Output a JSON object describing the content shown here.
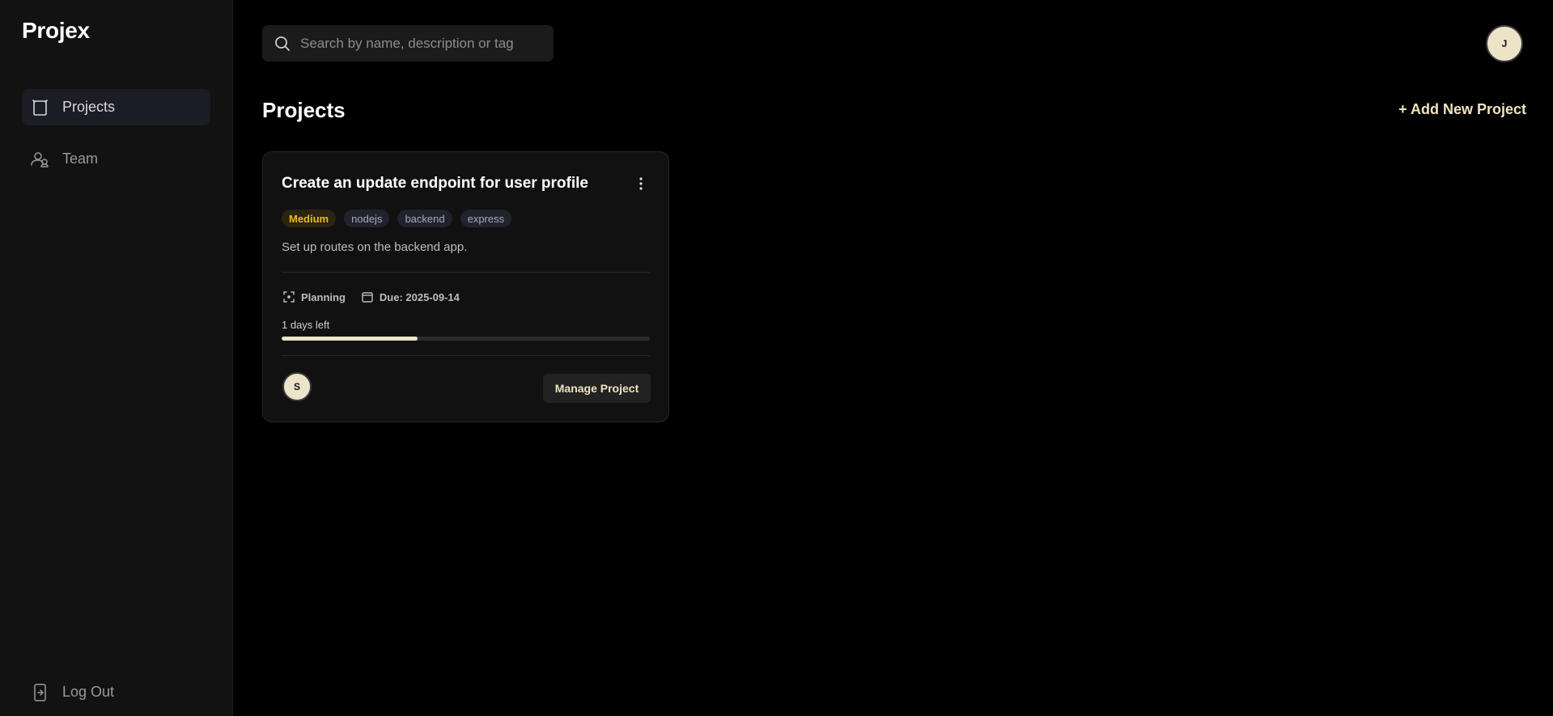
{
  "app": {
    "brand": "Projex"
  },
  "sidebar": {
    "items": [
      {
        "label": "Projects",
        "icon": "projects-icon",
        "active": true
      },
      {
        "label": "Team",
        "icon": "team-icon",
        "active": false
      }
    ],
    "logout_label": "Log Out",
    "logout_icon": "logout-icon"
  },
  "header": {
    "search_placeholder": "Search by name, description or tag",
    "search_value": "",
    "user_initial": "J"
  },
  "main": {
    "title": "Projects",
    "add_label": "+ Add New Project"
  },
  "projects": [
    {
      "title": "Create an update endpoint for user profile",
      "priority": "Medium",
      "tags": [
        "nodejs",
        "backend",
        "express"
      ],
      "description": "Set up routes on the backend app.",
      "status": "Planning",
      "due": "Due: 2025-09-14",
      "days_left": "1 days left",
      "progress_fraction": 0.37,
      "member_initial": "S",
      "manage_label": "Manage Project"
    }
  ],
  "colors": {
    "accent": "#ece3c8",
    "accent_text": "#f1e3bf",
    "priority_medium": "#e9b82a",
    "background": "#000000",
    "sidebar": "#121212",
    "card": "#111111"
  }
}
